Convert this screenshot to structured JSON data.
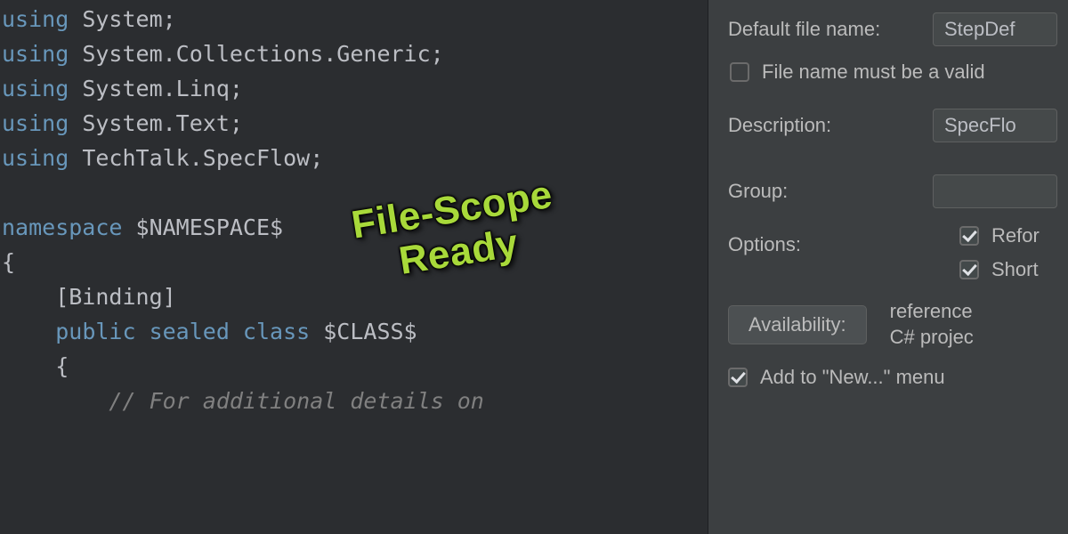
{
  "code": {
    "tokens": [
      {
        "type": "kw",
        "text": "using"
      },
      {
        "type": "plain",
        "text": " System;"
      },
      {
        "type": "nl"
      },
      {
        "type": "kw",
        "text": "using"
      },
      {
        "type": "plain",
        "text": " System.Collections.Generic;"
      },
      {
        "type": "nl"
      },
      {
        "type": "kw",
        "text": "using"
      },
      {
        "type": "plain",
        "text": " System.Linq;"
      },
      {
        "type": "nl"
      },
      {
        "type": "kw",
        "text": "using"
      },
      {
        "type": "plain",
        "text": " System.Text;"
      },
      {
        "type": "nl"
      },
      {
        "type": "kw",
        "text": "using"
      },
      {
        "type": "plain",
        "text": " TechTalk.SpecFlow;"
      },
      {
        "type": "nl"
      },
      {
        "type": "nl"
      },
      {
        "type": "kw",
        "text": "namespace"
      },
      {
        "type": "plain",
        "text": " $NAMESPACE$"
      },
      {
        "type": "nl"
      },
      {
        "type": "plain",
        "text": "{"
      },
      {
        "type": "nl"
      },
      {
        "type": "plain",
        "text": "    [Binding]"
      },
      {
        "type": "nl"
      },
      {
        "type": "plain",
        "text": "    "
      },
      {
        "type": "kw",
        "text": "public sealed class"
      },
      {
        "type": "plain",
        "text": " $CLASS$"
      },
      {
        "type": "nl"
      },
      {
        "type": "plain",
        "text": "    {"
      },
      {
        "type": "nl"
      },
      {
        "type": "plain",
        "text": "        "
      },
      {
        "type": "comment",
        "text": "// For additional details on"
      }
    ]
  },
  "panel": {
    "default_file_name_label": "Default file name:",
    "default_file_name_value": "StepDef",
    "file_name_checkbox_label": "File name must be a valid",
    "file_name_checked": false,
    "description_label": "Description:",
    "description_value": "SpecFlo",
    "group_label": "Group:",
    "group_value": "",
    "options_label": "Options:",
    "option_reformat_checked": true,
    "option_reformat_label": "Refor",
    "option_shorten_checked": true,
    "option_shorten_label": "Short",
    "availability_button": "Availability:",
    "availability_text_line1": "reference",
    "availability_text_line2": "C# projec",
    "add_to_new_checked": true,
    "add_to_new_label": "Add to \"New...\" menu"
  },
  "overlay": {
    "line1": "File-Scope",
    "line2": "Ready"
  }
}
